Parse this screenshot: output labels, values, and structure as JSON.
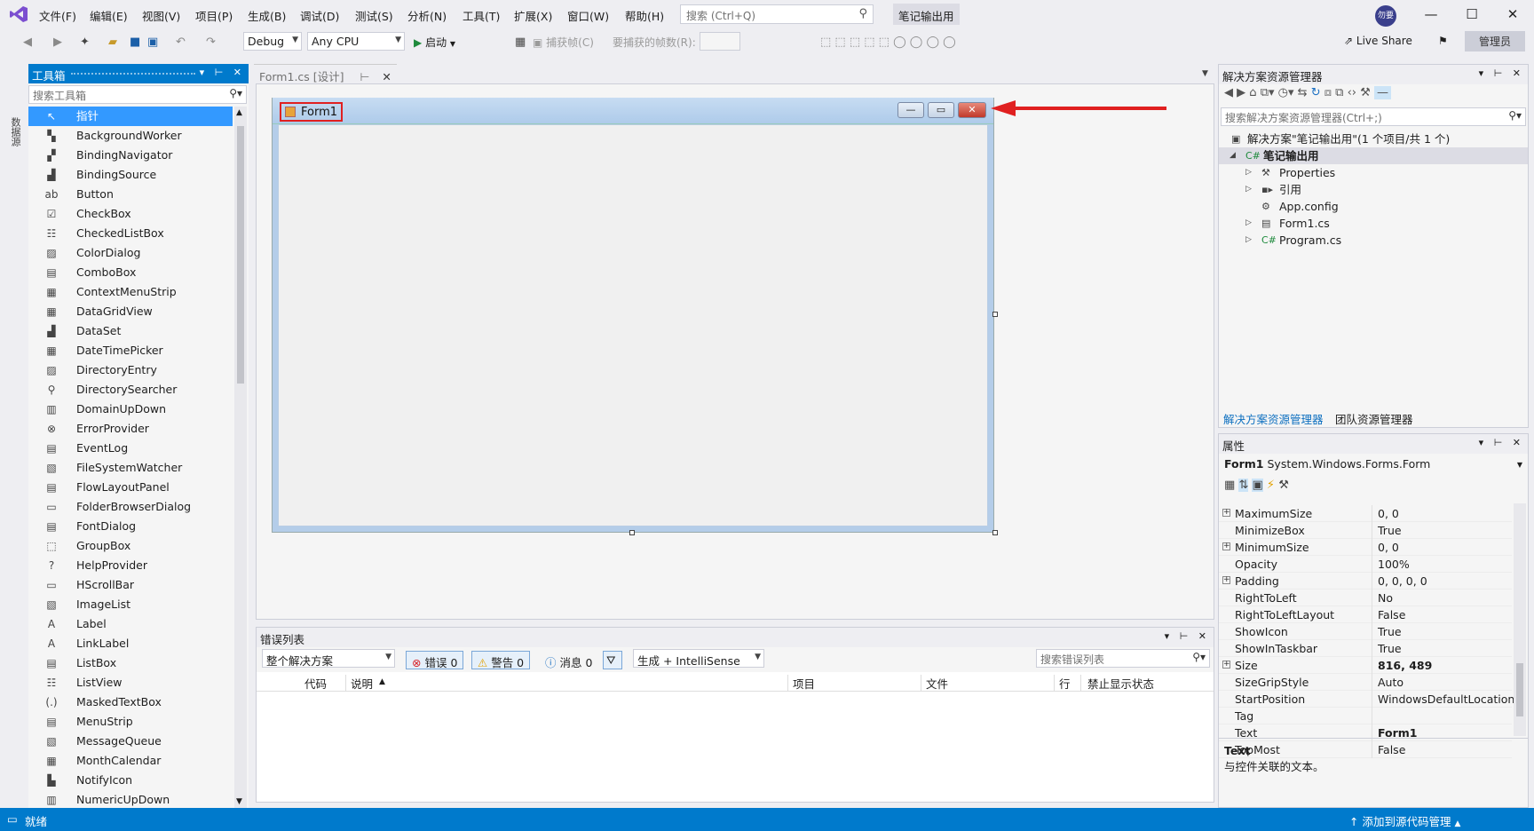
{
  "menubar": {
    "items": [
      "文件(F)",
      "编辑(E)",
      "视图(V)",
      "项目(P)",
      "生成(B)",
      "调试(D)",
      "测试(S)",
      "分析(N)",
      "工具(T)",
      "扩展(X)",
      "窗口(W)",
      "帮助(H)"
    ],
    "search_placeholder": "搜索 (Ctrl+Q)",
    "project_title": "笔记输出用",
    "avatar_initials": "勿要",
    "window_controls": [
      "—",
      "☐",
      "✕"
    ]
  },
  "toolbar": {
    "config": "Debug",
    "platform": "Any CPU",
    "start_label": "启动",
    "capture_label": "捕获帧(C)",
    "frames_label": "要捕获的帧数(R):",
    "live_share": "Live Share",
    "admin": "管理员"
  },
  "sidestrip": {
    "label": "数据源"
  },
  "toolbox": {
    "title": "工具箱",
    "search_placeholder": "搜索工具箱",
    "items": [
      {
        "label": "指针",
        "icon": "pointer-icon",
        "glyph": "↖"
      },
      {
        "label": "BackgroundWorker",
        "icon": "backgroundworker-icon",
        "glyph": "▚"
      },
      {
        "label": "BindingNavigator",
        "icon": "bindingnavigator-icon",
        "glyph": "▞"
      },
      {
        "label": "BindingSource",
        "icon": "bindingsource-icon",
        "glyph": "▟"
      },
      {
        "label": "Button",
        "icon": "button-icon",
        "glyph": "ab"
      },
      {
        "label": "CheckBox",
        "icon": "checkbox-icon",
        "glyph": "☑"
      },
      {
        "label": "CheckedListBox",
        "icon": "checkedlistbox-icon",
        "glyph": "☷"
      },
      {
        "label": "ColorDialog",
        "icon": "colordialog-icon",
        "glyph": "▨"
      },
      {
        "label": "ComboBox",
        "icon": "combobox-icon",
        "glyph": "▤"
      },
      {
        "label": "ContextMenuStrip",
        "icon": "contextmenustrip-icon",
        "glyph": "▦"
      },
      {
        "label": "DataGridView",
        "icon": "datagridview-icon",
        "glyph": "▦"
      },
      {
        "label": "DataSet",
        "icon": "dataset-icon",
        "glyph": "▟"
      },
      {
        "label": "DateTimePicker",
        "icon": "datetimepicker-icon",
        "glyph": "▦"
      },
      {
        "label": "DirectoryEntry",
        "icon": "directoryentry-icon",
        "glyph": "▨"
      },
      {
        "label": "DirectorySearcher",
        "icon": "directorysearcher-icon",
        "glyph": "⚲"
      },
      {
        "label": "DomainUpDown",
        "icon": "domainupdown-icon",
        "glyph": "▥"
      },
      {
        "label": "ErrorProvider",
        "icon": "errorprovider-icon",
        "glyph": "⊗"
      },
      {
        "label": "EventLog",
        "icon": "eventlog-icon",
        "glyph": "▤"
      },
      {
        "label": "FileSystemWatcher",
        "icon": "filesystemwatcher-icon",
        "glyph": "▧"
      },
      {
        "label": "FlowLayoutPanel",
        "icon": "flowlayoutpanel-icon",
        "glyph": "▤"
      },
      {
        "label": "FolderBrowserDialog",
        "icon": "folderbrowserdialog-icon",
        "glyph": "▭"
      },
      {
        "label": "FontDialog",
        "icon": "fontdialog-icon",
        "glyph": "▤"
      },
      {
        "label": "GroupBox",
        "icon": "groupbox-icon",
        "glyph": "⬚"
      },
      {
        "label": "HelpProvider",
        "icon": "helpprovider-icon",
        "glyph": "?"
      },
      {
        "label": "HScrollBar",
        "icon": "hscrollbar-icon",
        "glyph": "▭"
      },
      {
        "label": "ImageList",
        "icon": "imagelist-icon",
        "glyph": "▧"
      },
      {
        "label": "Label",
        "icon": "label-icon",
        "glyph": "A"
      },
      {
        "label": "LinkLabel",
        "icon": "linklabel-icon",
        "glyph": "A"
      },
      {
        "label": "ListBox",
        "icon": "listbox-icon",
        "glyph": "▤"
      },
      {
        "label": "ListView",
        "icon": "listview-icon",
        "glyph": "☷"
      },
      {
        "label": "MaskedTextBox",
        "icon": "maskedtextbox-icon",
        "glyph": "(.)"
      },
      {
        "label": "MenuStrip",
        "icon": "menustrip-icon",
        "glyph": "▤"
      },
      {
        "label": "MessageQueue",
        "icon": "messagequeue-icon",
        "glyph": "▧"
      },
      {
        "label": "MonthCalendar",
        "icon": "monthcalendar-icon",
        "glyph": "▦"
      },
      {
        "label": "NotifyIcon",
        "icon": "notifyicon-icon",
        "glyph": "▙"
      },
      {
        "label": "NumericUpDown",
        "icon": "numericupdown-icon",
        "glyph": "▥"
      }
    ]
  },
  "document": {
    "tab_label": "Form1.cs [设计]",
    "form_title": "Form1"
  },
  "errorlist": {
    "title": "错误列表",
    "scope": "整个解决方案",
    "errors": "错误 0",
    "warnings": "警告 0",
    "messages": "消息 0",
    "build_filter": "生成 + IntelliSense",
    "search_placeholder": "搜索错误列表",
    "columns": [
      "代码",
      "说明",
      "项目",
      "文件",
      "行",
      "禁止显示状态"
    ]
  },
  "solution": {
    "title": "解决方案资源管理器",
    "search_placeholder": "搜索解决方案资源管理器(Ctrl+;)",
    "solution_line": "解决方案\"笔记输出用\"(1 个项目/共 1 个)",
    "project": "笔记输出用",
    "children": [
      "Properties",
      "引用",
      "App.config",
      "Form1.cs",
      "Program.cs"
    ],
    "bottom_tabs": [
      "解决方案资源管理器",
      "团队资源管理器"
    ]
  },
  "properties": {
    "title": "属性",
    "object_name": "Form1",
    "object_type": "System.Windows.Forms.Form",
    "rows": [
      {
        "name": "MaximumSize",
        "value": "0, 0",
        "expand": true,
        "bold": false
      },
      {
        "name": "MinimizeBox",
        "value": "True",
        "expand": false,
        "bold": false
      },
      {
        "name": "MinimumSize",
        "value": "0, 0",
        "expand": true,
        "bold": false
      },
      {
        "name": "Opacity",
        "value": "100%",
        "expand": false,
        "bold": false
      },
      {
        "name": "Padding",
        "value": "0, 0, 0, 0",
        "expand": true,
        "bold": false
      },
      {
        "name": "RightToLeft",
        "value": "No",
        "expand": false,
        "bold": false
      },
      {
        "name": "RightToLeftLayout",
        "value": "False",
        "expand": false,
        "bold": false
      },
      {
        "name": "ShowIcon",
        "value": "True",
        "expand": false,
        "bold": false
      },
      {
        "name": "ShowInTaskbar",
        "value": "True",
        "expand": false,
        "bold": false
      },
      {
        "name": "Size",
        "value": "816, 489",
        "expand": true,
        "bold": true
      },
      {
        "name": "SizeGripStyle",
        "value": "Auto",
        "expand": false,
        "bold": false
      },
      {
        "name": "StartPosition",
        "value": "WindowsDefaultLocation",
        "expand": false,
        "bold": false
      },
      {
        "name": "Tag",
        "value": "",
        "expand": false,
        "bold": false
      },
      {
        "name": "Text",
        "value": "Form1",
        "expand": false,
        "bold": true
      },
      {
        "name": "TopMost",
        "value": "False",
        "expand": false,
        "bold": false
      }
    ],
    "desc_title": "Text",
    "desc_text": "与控件关联的文本。"
  },
  "statusbar": {
    "status": "就绪",
    "source_control": "添加到源代码管理"
  },
  "colors": {
    "accent": "#007acc",
    "selection": "#3399ff",
    "annotation_red": "#e02020"
  }
}
